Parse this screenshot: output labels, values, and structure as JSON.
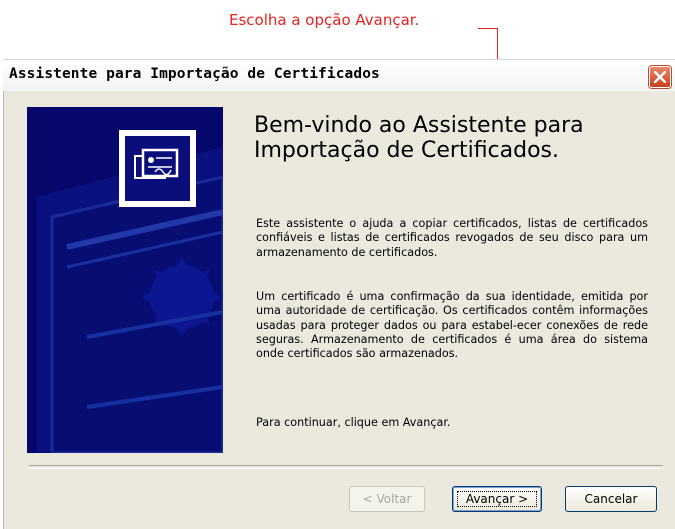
{
  "callout": {
    "text": "Escolha a opção Avançar.",
    "color": "#e8231f"
  },
  "window": {
    "title": "Assistente para Importação de Certificados",
    "close_icon": "close-icon"
  },
  "wizard": {
    "heading_line1": "Bem-vindo ao Assistente para",
    "heading_line2": "Importação de Certificados.",
    "paragraph1": "Este assistente o ajuda a copiar certificados, listas de certificados confiáveis e listas de certificados revogados de seu disco para um armazenamento de certificados.",
    "paragraph2": "Um certificado é uma confirmação da sua identidade, emitida por uma autoridade de certificação. Os certificados contêm informações usadas para proteger dados ou para estabel-ecer conexões de rede seguras. Armazenamento de certificados é uma área do sistema onde certificados são armazenados.",
    "paragraph3": "Para continuar, clique em Avançar."
  },
  "buttons": {
    "back": "< Voltar",
    "next": "Avançar >",
    "cancel": "Cancelar"
  },
  "icons": {
    "certificate": "certificate-icon"
  },
  "colors": {
    "panel": "#05086a",
    "dialog_bg": "#ebe9de"
  }
}
